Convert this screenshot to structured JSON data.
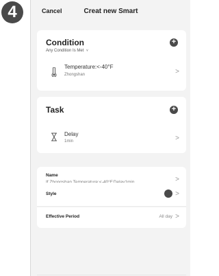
{
  "step_badge": "4",
  "nav": {
    "cancel": "Cancel",
    "title": "Creat new Smart"
  },
  "condition": {
    "title": "Condition",
    "subtitle": "Any Condition Is Met",
    "subtitle_chevron": "˅",
    "item": {
      "label": "Temperature:<-40°F",
      "sub": "Zhongshan",
      "icon": "thermometer-icon"
    }
  },
  "task": {
    "title": "Task",
    "item": {
      "label": "Delay",
      "sub": "1min",
      "icon": "hourglass-icon"
    }
  },
  "name": {
    "label": "Name",
    "value": "If Zhongshan Temperature:<-40°F,Delay1min..."
  },
  "style": {
    "label": "Style",
    "color": "#4a4a4a"
  },
  "effective_period": {
    "label": "Effective Period",
    "value": "All day"
  },
  "plus_symbol": "+",
  "chevron": ">"
}
